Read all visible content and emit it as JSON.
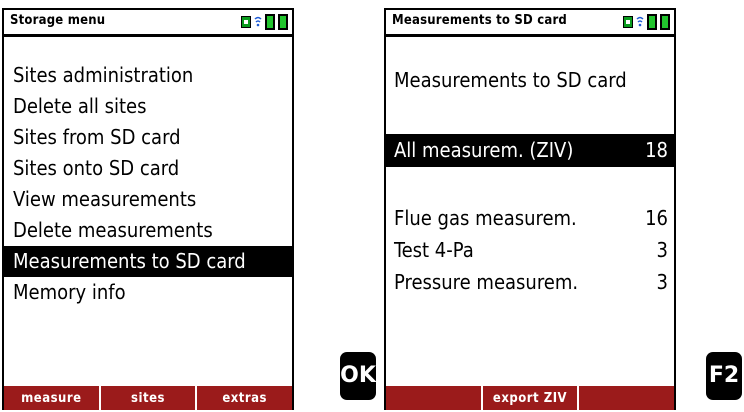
{
  "left": {
    "title": "Storage menu",
    "items": [
      {
        "label": "Sites administration"
      },
      {
        "label": "Delete all sites"
      },
      {
        "label": "Sites from SD card"
      },
      {
        "label": "Sites onto SD card"
      },
      {
        "label": "View measurements"
      },
      {
        "label": "Delete measurements"
      },
      {
        "label": "Measurements to SD card",
        "selected": true
      },
      {
        "label": "Memory info"
      }
    ],
    "softkeys": [
      "measure",
      "sites",
      "extras"
    ]
  },
  "right": {
    "title": "Measurements to SD card",
    "heading": "Measurements to SD card",
    "selected_row": {
      "label": "All measurem. (ZIV)",
      "count": "18"
    },
    "rows": [
      {
        "label": "Flue gas measurem.",
        "count": "16"
      },
      {
        "label": "Test 4-Pa",
        "count": "3"
      },
      {
        "label": "Pressure measurem.",
        "count": "3"
      }
    ],
    "softkeys": [
      "",
      "export ZIV",
      ""
    ]
  },
  "keys": {
    "ok": "OK",
    "f2": "F2"
  },
  "status_icons": [
    "plug-icon",
    "wifi-icon",
    "battery-icon",
    "battery-icon"
  ],
  "colors": {
    "softkey_bar": "#9b1b1b",
    "battery": "#22c52e",
    "plug": "#0a9c1e"
  }
}
